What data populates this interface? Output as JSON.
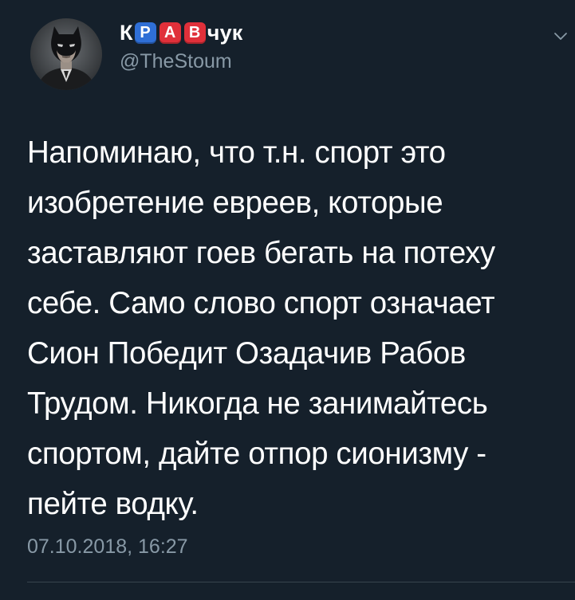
{
  "author": {
    "name_prefix": "К",
    "name_tiles": [
      {
        "letter": "Р",
        "color": "#2f6fd6"
      },
      {
        "letter": "А",
        "color": "#e0303a"
      },
      {
        "letter": "В",
        "color": "#e0303a"
      }
    ],
    "name_suffix": "чук",
    "handle": "@TheStoum",
    "avatar_icon": "batman-mask-avatar"
  },
  "menu": {
    "icon": "chevron-down-icon"
  },
  "tweet": {
    "lines": [
      "Напоминаю, что т.н. спорт это",
      "изобретение евреев, которые",
      "заставляют гоев бегать на потеху",
      "себе. Само слово спорт означает",
      "Сион Победит Озадачив Рабов",
      "Трудом. Никогда не занимайтесь",
      "спортом, дайте отпор сионизму -",
      "пейте водку."
    ],
    "timestamp": "07.10.2018, 16:27"
  },
  "colors": {
    "background": "#15202b",
    "text_primary": "#ffffff",
    "text_secondary": "#8899a6",
    "divider": "#38444d"
  }
}
